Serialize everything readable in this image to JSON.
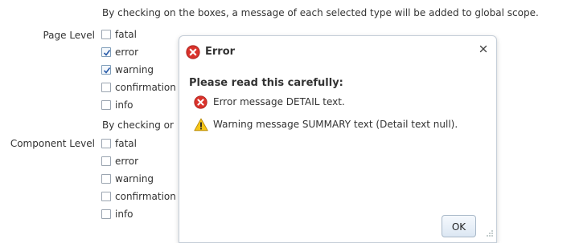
{
  "intro_text": "By checking on the boxes, a message of each selected type will be added to global scope.",
  "intro_text_truncated": "By checking or",
  "page_level": {
    "label": "Page Level",
    "options": [
      {
        "label": "fatal",
        "checked": false
      },
      {
        "label": "error",
        "checked": true
      },
      {
        "label": "warning",
        "checked": true
      },
      {
        "label": "confirmation",
        "checked": false
      },
      {
        "label": "info",
        "checked": false
      }
    ]
  },
  "component_level": {
    "label": "Component Level",
    "options": [
      {
        "label": "fatal",
        "checked": false
      },
      {
        "label": "error",
        "checked": false
      },
      {
        "label": "warning",
        "checked": false
      },
      {
        "label": "confirmation",
        "checked": false
      },
      {
        "label": "info",
        "checked": false
      }
    ]
  },
  "dialog": {
    "title": "Error",
    "instruction": "Please read this carefully:",
    "messages": [
      {
        "severity": "error",
        "icon": "error-icon",
        "text": "Error message DETAIL text."
      },
      {
        "severity": "warning",
        "icon": "warning-icon",
        "text": "Warning message SUMMARY text (Detail text null)."
      }
    ],
    "ok_label": "OK",
    "close_icon": "close-icon"
  },
  "colors": {
    "error_red": "#d9322b",
    "warning_yellow": "#f5c518",
    "text": "#333333"
  }
}
